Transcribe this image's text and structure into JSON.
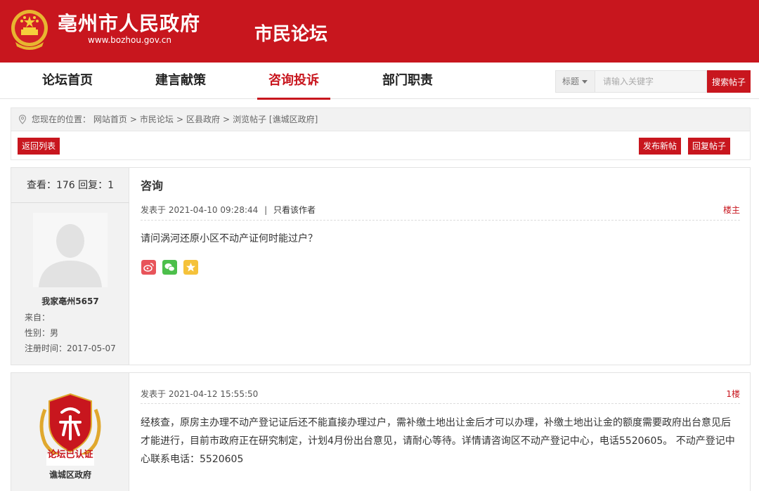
{
  "header": {
    "site_title": "亳州市人民政府",
    "site_url": "www.bozhou.gov.cn",
    "forum_title": "市民论坛",
    "brand_color": "#c8161e"
  },
  "nav": {
    "items": [
      {
        "label": "论坛首页",
        "active": false
      },
      {
        "label": "建言献策",
        "active": false
      },
      {
        "label": "咨询投诉",
        "active": true
      },
      {
        "label": "部门职责",
        "active": false
      }
    ]
  },
  "search": {
    "scope_label": "标题",
    "placeholder": "请输入关键字",
    "button_label": "搜索帖子"
  },
  "breadcrumb": {
    "prefix": "您现在的位置：",
    "items": [
      "网站首页",
      "市民论坛",
      "区县政府",
      "浏览帖子 [谯城区政府]"
    ],
    "separator": ">"
  },
  "actions": {
    "back_label": "返回列表",
    "new_post_label": "发布新帖",
    "reply_label": "回复帖子"
  },
  "posts": [
    {
      "stats": "查看：176 回复：1",
      "title": "咨询",
      "meta": "发表于 2021-04-10 09:28:44",
      "meta_sep": "|",
      "author_only": "只看该作者",
      "floor": "楼主",
      "body": "请问涡河还原小区不动产证何时能过户？",
      "user": {
        "name": "我家亳州5657",
        "from": "来自：",
        "gender": "性别：男",
        "registered": "注册时间：2017-05-07"
      },
      "share_icons": [
        "weibo-icon",
        "wechat-icon",
        "qzone-icon"
      ]
    },
    {
      "meta": "发表于 2021-04-12 15:55:50",
      "floor": "1楼",
      "body": "经核查，原房主办理不动产登记证后还不能直接办理过户，需补缴土地出让金后才可以办理，补缴土地出让金的额度需要政府出台意见后才能进行，目前市政府正在研究制定，计划4月份出台意见，请耐心等待。详情请咨询区不动产登记中心，电话5520605。 不动产登记中心联系电话：5520605",
      "user": {
        "name": "谯城区政府",
        "badge_text": "论坛已认证"
      }
    }
  ]
}
